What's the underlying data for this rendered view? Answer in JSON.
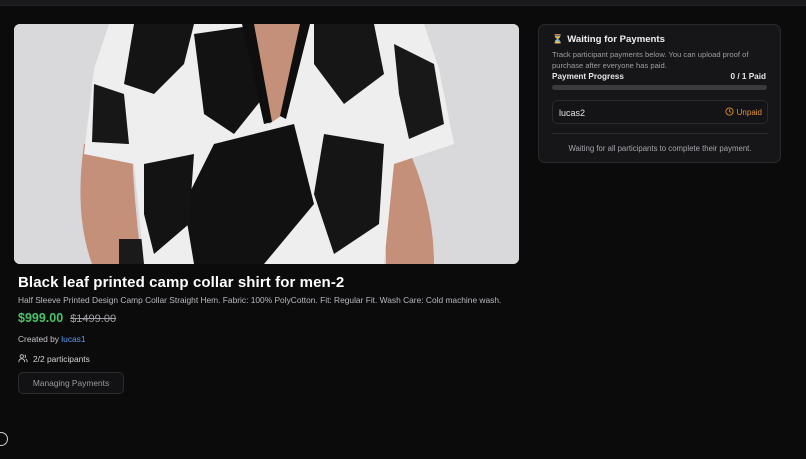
{
  "product": {
    "title": "Black leaf printed camp collar shirt for men-2",
    "description": "Half Sleeve Printed Design Camp Collar Straight Hem. Fabric: 100% PolyCotton. Fit: Regular Fit. Wash Care: Cold machine wash.",
    "price": "$999.00",
    "old_price": "$1499.00",
    "created_by_label": "Created by",
    "creator": "lucas1",
    "participants_text": "2/2 participants",
    "manage_button": "Managing Payments"
  },
  "payments": {
    "icon": "hourglass-icon",
    "title": "Waiting for Payments",
    "subtitle": "Track participant payments below. You can upload proof of purchase after everyone has paid.",
    "progress_label": "Payment Progress",
    "progress_count": "0 / 1 Paid",
    "progress_fraction": 0,
    "participants": [
      {
        "name": "lucas2",
        "status": "Unpaid"
      }
    ],
    "waiting_text": "Waiting for all participants to complete their payment."
  },
  "colors": {
    "background": "#0b0b0c",
    "price": "#4cc36a",
    "link": "#5b9cf2",
    "unpaid": "#e0912f"
  }
}
